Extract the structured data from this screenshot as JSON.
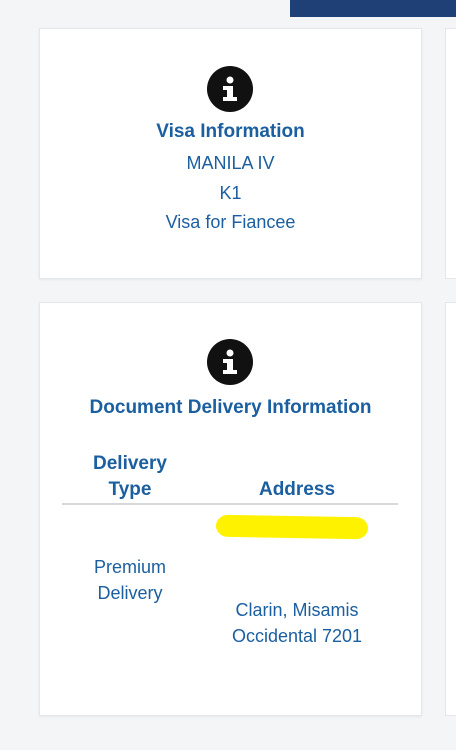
{
  "visa_card": {
    "title": "Visa Information",
    "lines": [
      "MANILA IV",
      "K1",
      "Visa for Fiancee"
    ]
  },
  "delivery_card": {
    "title": "Document Delivery Information",
    "columns": [
      "Delivery Type",
      "Address"
    ],
    "row": {
      "delivery_type": "Premium Delivery",
      "address": "Clarin, Misamis Occidental 7201"
    }
  },
  "colors": {
    "accent_text": "#1b5fa0",
    "topbar": "#1f3f77",
    "redaction": "#fff200"
  },
  "icons": [
    "info-icon",
    "info-icon"
  ]
}
